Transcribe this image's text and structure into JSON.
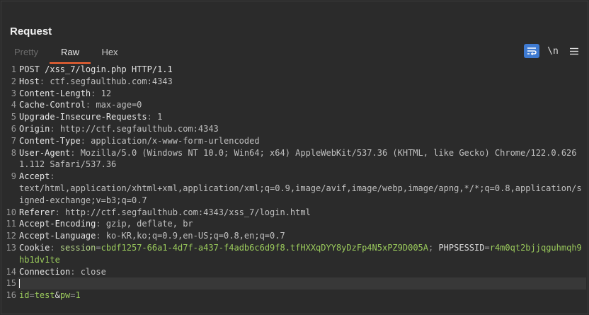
{
  "panel": {
    "title": "Request",
    "tabs": [
      {
        "label": "Pretty"
      },
      {
        "label": "Raw"
      },
      {
        "label": "Hex"
      }
    ],
    "active_tab": "Raw",
    "tools": {
      "wrap_icon": "wrap-lines-icon",
      "newline_label": "\\n",
      "menu_icon": "hamburger-menu-icon"
    }
  },
  "lines": {
    "l1": {
      "num": "1",
      "text": "POST /xss_7/login.php HTTP/1.1"
    },
    "l2": {
      "num": "2",
      "name": "Host",
      "sep": ": ",
      "value": "ctf.segfaulthub.com:4343"
    },
    "l3": {
      "num": "3",
      "name": "Content-Length",
      "sep": ": ",
      "value": "12"
    },
    "l4": {
      "num": "4",
      "name": "Cache-Control",
      "sep": ": ",
      "value": "max-age=0"
    },
    "l5": {
      "num": "5",
      "name": "Upgrade-Insecure-Requests",
      "sep": ": ",
      "value": "1"
    },
    "l6": {
      "num": "6",
      "name": "Origin",
      "sep": ": ",
      "value": "http://ctf.segfaulthub.com:4343"
    },
    "l7": {
      "num": "7",
      "name": "Content-Type",
      "sep": ": ",
      "value": "application/x-www-form-urlencoded"
    },
    "l8": {
      "num": "8",
      "name": "User-Agent",
      "sep": ": ",
      "value": "Mozilla/5.0 (Windows NT 10.0; Win64; x64) AppleWebKit/537.36 (KHTML, like Gecko) Chrome/122.0.6261.112 Safari/537.36"
    },
    "l9": {
      "num": "9",
      "name": "Accept",
      "sep": ": ",
      "value": "text/html,application/xhtml+xml,application/xml;q=0.9,image/avif,image/webp,image/apng,*/*;q=0.8,application/signed-exchange;v=b3;q=0.7"
    },
    "l10": {
      "num": "10",
      "name": "Referer",
      "sep": ": ",
      "value": "http://ctf.segfaulthub.com:4343/xss_7/login.html"
    },
    "l11": {
      "num": "11",
      "name": "Accept-Encoding",
      "sep": ": ",
      "value": "gzip, deflate, br"
    },
    "l12": {
      "num": "12",
      "name": "Accept-Language",
      "sep": ": ",
      "value": "ko-KR,ko;q=0.9,en-US;q=0.8,en;q=0.7"
    },
    "l13": {
      "num": "13",
      "name": "Cookie",
      "sep": ": ",
      "c1_key": "session",
      "c1_eq": "=",
      "c1_val": "cbdf1257-66a1-4d7f-a437-f4adb6c6d9f8.tfHXXqDYY8yDzFp4N5xPZ9D005A",
      "c_sep": "; ",
      "c2_key": "PHPSESSID",
      "c2_eq": "=",
      "c2_val": "r4m0qt2bjjqguhmqh9hb1dv1te"
    },
    "l14": {
      "num": "14",
      "name": "Connection",
      "sep": ": ",
      "value": "close"
    },
    "l15": {
      "num": "15"
    },
    "l16": {
      "num": "16",
      "p1_key": "id",
      "p1_eq": "=",
      "p1_val": "test",
      "amp": "&",
      "p2_key": "pw",
      "p2_eq": "=",
      "p2_val": "1"
    }
  },
  "colors": {
    "accent": "#ff6633",
    "button_active": "#3e7ad1",
    "cookie_value": "#9bcb5c"
  }
}
